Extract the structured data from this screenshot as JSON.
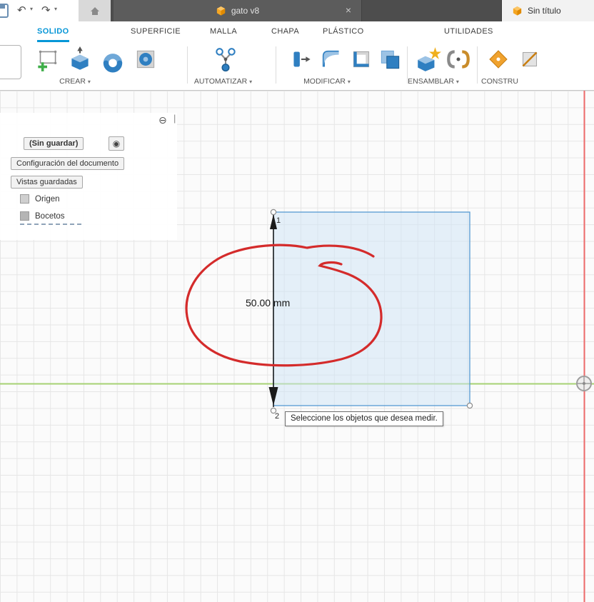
{
  "window": {
    "undo": "↶",
    "redo": "↷",
    "caret": "▾",
    "doc_tab": "gato v8",
    "doc_tab_close": "×",
    "untitled_tab": "Sin título"
  },
  "ribbon": {
    "tabs": [
      "SOLIDO",
      "SUPERFICIE",
      "MALLA",
      "CHAPA",
      "PLÁSTICO",
      "UTILIDADES"
    ],
    "active_tab": "SOLIDO",
    "groups": {
      "crear": "CREAR",
      "automatizar": "AUTOMATIZAR",
      "modificar": "MODIFICAR",
      "ensamblar": "ENSAMBLAR",
      "construir": "CONSTRU",
      "caret": "▾"
    }
  },
  "browser": {
    "collapse": "⊖",
    "grip": "|",
    "unsaved_label": "(Sin guardar)",
    "radio": "◉",
    "doc_settings": "Configuración del documento",
    "saved_views": "Vistas guardadas",
    "origin": "Origen",
    "sketches": "Bocetos"
  },
  "sketch": {
    "dimension_label": "50.00 mm",
    "point_1": "1",
    "point_2": "2"
  },
  "tooltip": "Seleccione los objetos que desea medir.",
  "colors": {
    "accent": "#0696d7",
    "doc_icon_orange": "#f5a623",
    "selection_blue": "#cde3f6",
    "annotation_red": "#d42b2b",
    "axis_x_green": "#a6d273",
    "axis_y_red": "#ee6a6a"
  }
}
